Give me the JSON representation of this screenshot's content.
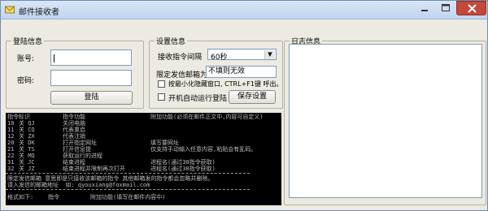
{
  "window": {
    "title": "邮件接收者"
  },
  "login": {
    "legend": "登陆信息",
    "account_label": "账号:",
    "account_value": "",
    "password_label": "密码:",
    "password_value": "",
    "login_button": "登陆"
  },
  "settings": {
    "legend": "设置信息",
    "interval_label": "接收指令间隔",
    "interval_value": "60秒",
    "mailbox_label": "限定发信邮箱为:",
    "mailbox_value": "不填则无效",
    "minimize_label": "按最小化隐藏窗口, CTRL+F1键 呼出。",
    "minimize_checked": false,
    "autostart_label": "开机自动运行登陆",
    "autostart_checked": false,
    "save_button": "保存设置"
  },
  "log": {
    "legend": "日志信息",
    "content": ""
  },
  "console": {
    "header": {
      "col1": "指令标识",
      "col2": "指令功能",
      "col3": "附加功能(必须在邮件正文中,内容可自定义)"
    },
    "rows": [
      {
        "id": "10",
        "code": "关 QJ",
        "func": "关闭电脑",
        "extra": ""
      },
      {
        "id": "11",
        "code": "关 CQ",
        "func": "代表重启",
        "extra": ""
      },
      {
        "id": "12",
        "code": "关 ZX",
        "func": "代表注销",
        "extra": ""
      },
      {
        "id": "20",
        "code": "关 DK",
        "func": "打开指定网址",
        "extra": "填写要网址"
      },
      {
        "id": "21",
        "code": "关 TS",
        "func": "打开信息提",
        "extra": "仅支持手动输入任意内容,粘贴会有乱码。"
      },
      {
        "id": "22",
        "code": "关 MQ",
        "func": "获取运行的进程",
        "extra": ""
      },
      {
        "id": "31",
        "code": "关 JC",
        "func": "结束进程",
        "extra": "进程名(通过30指令获取)"
      },
      {
        "id": "32",
        "code": "关 JZ",
        "func": "结束进程并限制再次打开",
        "extra": "进程名(通过30指令获取)"
      }
    ],
    "note1": "限定发信邮箱 意思即是只接收该邮箱的指令 其他邮箱发的指令都会忽略并删除。",
    "note2": "请入发信的邮箱地址  如: qyouxiang@foxmail.com",
    "format": {
      "label": "格式如下:",
      "col1": "指令",
      "col2": "附加功能(填写在邮件内容中)"
    }
  }
}
